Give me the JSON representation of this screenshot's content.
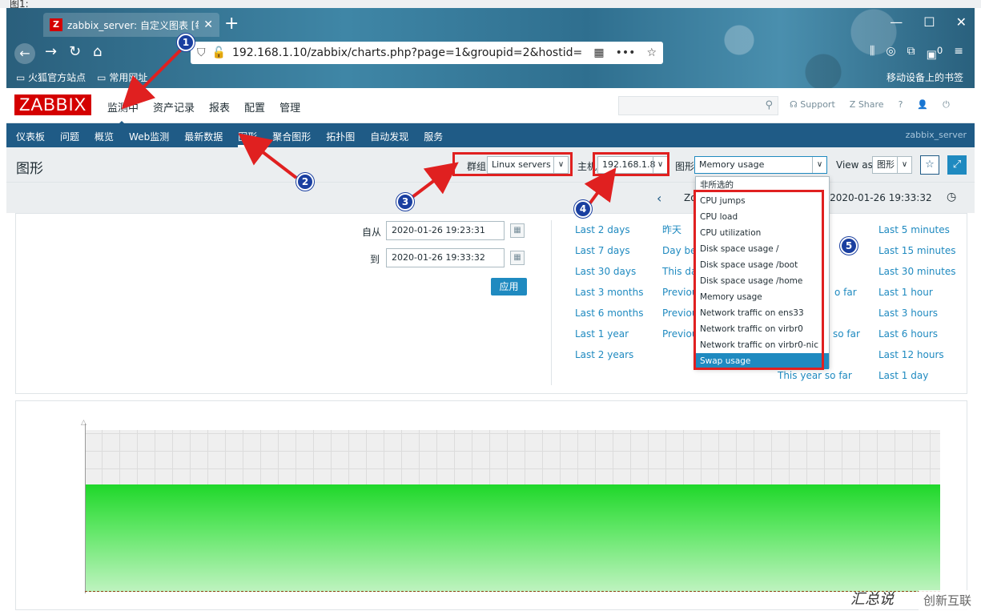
{
  "browser": {
    "leaked_text": "图1:",
    "tab_title": "zabbix_server: 自定义图表 [每",
    "favicon_letter": "Z",
    "url": "192.168.1.10/zabbix/charts.php?page=1&groupid=2&hostid=",
    "bookmarks": [
      "火狐官方站点",
      "常用网址"
    ],
    "mobile_bookmarks": "移动设备上的书签",
    "badge": "0"
  },
  "header": {
    "logo": "ZABBIX",
    "menu": [
      "监测中",
      "资产记录",
      "报表",
      "配置",
      "管理"
    ],
    "support": "Support",
    "share": "Share",
    "help": "?"
  },
  "subnav": {
    "items": [
      "仪表板",
      "问题",
      "概览",
      "Web监测",
      "最新数据",
      "图形",
      "聚合图形",
      "拓扑图",
      "自动发现",
      "服务"
    ],
    "server": "zabbix_server"
  },
  "page": {
    "title": "图形",
    "group_label": "群组",
    "group_value": "Linux servers",
    "host_label": "主机",
    "host_value": "192.168.1.8",
    "graph_label": "图形",
    "graph_value": "Memory usage",
    "viewas_label": "View as",
    "viewas_value": "图形"
  },
  "timebar": {
    "zoom_prefix": "Zo",
    "range_end": "3:31 – 2020-01-26 19:33:32"
  },
  "filter": {
    "from_label": "自从",
    "from_value": "2020-01-26 19:23:31",
    "to_label": "到",
    "to_value": "2020-01-26 19:33:32",
    "apply": "应用",
    "col1": [
      "Last 2 days",
      "Last 7 days",
      "Last 30 days",
      "Last 3 months",
      "Last 6 months",
      "Last 1 year",
      "Last 2 years"
    ],
    "col2": [
      "昨天",
      "Day be",
      "This da",
      "Previou",
      "Previou",
      "Previou"
    ],
    "col3": [
      "o far",
      "so far",
      "This year so far"
    ],
    "col4": [
      "Last 5 minutes",
      "Last 15 minutes",
      "Last 30 minutes",
      "Last 1 hour",
      "Last 3 hours",
      "Last 6 hours",
      "Last 12 hours",
      "Last 1 day"
    ]
  },
  "dropdown": {
    "options": [
      "非所选的",
      "CPU jumps",
      "CPU load",
      "CPU utilization",
      "Disk space usage /",
      "Disk space usage /boot",
      "Disk space usage /home",
      "Memory usage",
      "Network traffic on ens33",
      "Network traffic on virbr0",
      "Network traffic on virbr0-nic",
      "Swap usage"
    ],
    "highlighted": "Swap usage"
  },
  "annotations": [
    "1",
    "2",
    "3",
    "4",
    "5"
  ],
  "watermark": "创新互联",
  "watermark2": "汇总说"
}
